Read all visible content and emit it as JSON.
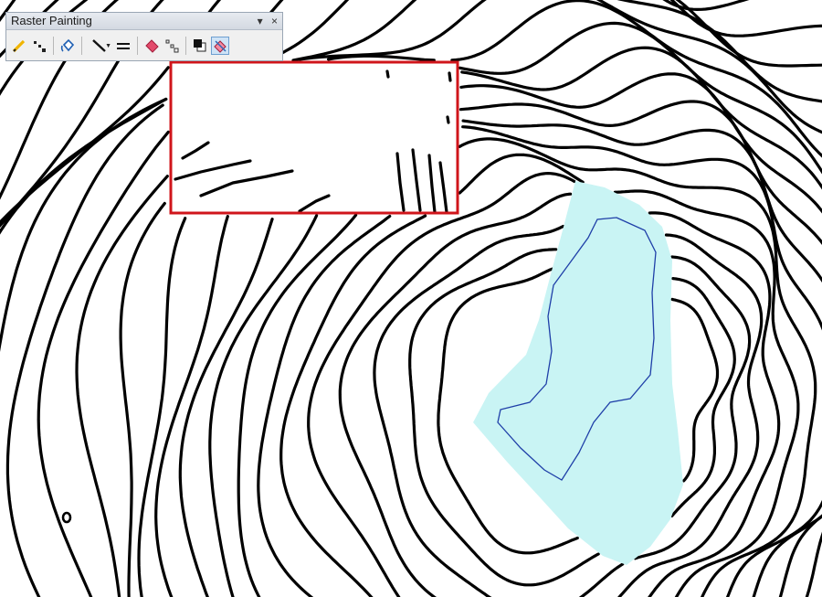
{
  "toolbar": {
    "title": "Raster Painting",
    "controls": {
      "dropdown_glyph": "▾",
      "close_glyph": "×"
    },
    "tools": [
      {
        "name": "pencil-icon"
      },
      {
        "name": "pixel-points-icon"
      },
      {
        "name": "paint-bucket-icon"
      },
      {
        "name": "line-width-icon"
      },
      {
        "name": "line-style-icon"
      },
      {
        "name": "eraser-icon"
      },
      {
        "name": "scatter-erase-icon"
      },
      {
        "name": "swap-colors-icon"
      },
      {
        "name": "magic-erase-icon",
        "active": true
      }
    ]
  },
  "map": {
    "background": "#ffffff",
    "contour_color": "#000000",
    "lake_fill": "#c9f4f4",
    "lake_outline": "#1f3fa8",
    "selection_color": "#d0151b"
  }
}
